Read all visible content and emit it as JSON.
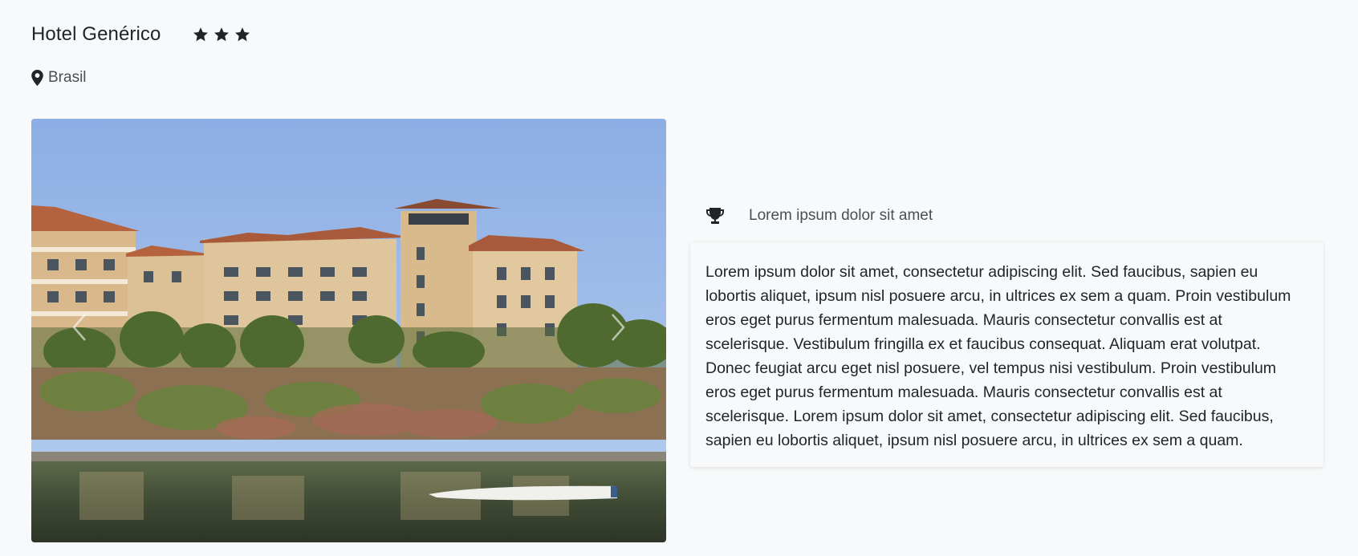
{
  "hotel": {
    "name": "Hotel Genérico",
    "stars": 3,
    "location": "Brasil"
  },
  "icons": {
    "star": "star-icon",
    "location": "map-marker-icon",
    "feature": "trophy-icon",
    "prev": "chevron-left-icon",
    "next": "chevron-right-icon"
  },
  "feature": {
    "label": "Lorem ipsum dolor sit amet"
  },
  "description": "Lorem ipsum dolor sit amet, consectetur adipiscing elit. Sed faucibus, sapien eu lobortis aliquet, ipsum nisl posuere arcu, in ultrices ex sem a quam. Proin vestibulum eros eget purus fermentum malesuada. Mauris consectetur convallis est at scelerisque. Vestibulum fringilla ex et faucibus consequat. Aliquam erat volutpat. Donec feugiat arcu eget nisl posuere, vel tempus nisi vestibulum. Proin vestibulum eros eget purus fermentum malesuada. Mauris consectetur convallis est at scelerisque. Lorem ipsum dolor sit amet, consectetur adipiscing elit. Sed faucibus, sapien eu lobortis aliquet, ipsum nisl posuere arcu, in ultrices ex sem a quam.",
  "colors": {
    "background": "#f8f9fa",
    "text": "#212529",
    "muted": "#495057"
  }
}
